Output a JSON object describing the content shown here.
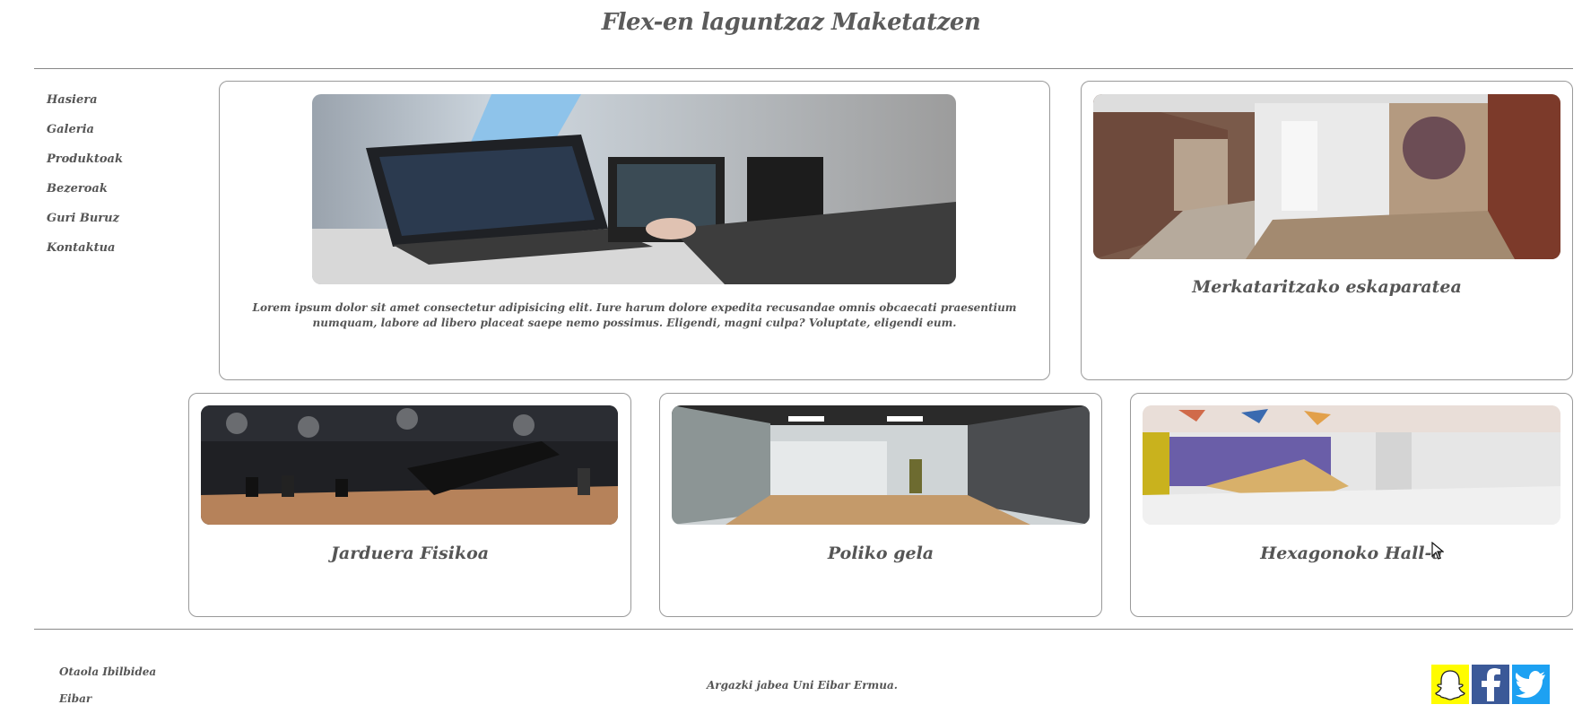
{
  "header": {
    "title": "Flex-en laguntzaz Maketatzen"
  },
  "nav": {
    "items": [
      {
        "label": "Hasiera"
      },
      {
        "label": "Galeria"
      },
      {
        "label": "Produktoak"
      },
      {
        "label": "Bezeroak"
      },
      {
        "label": "Guri Buruz"
      },
      {
        "label": "Kontaktua"
      }
    ]
  },
  "cards": {
    "main": {
      "text": "Lorem ipsum dolor sit amet consectetur adipisicing elit. Iure harum dolore expedita recusandae omnis obcaecati praesentium numquam, labore ad libero placeat saepe nemo possimus. Eligendi, magni culpa? Voluptate, eligendi eum."
    },
    "shop": {
      "caption": "Merkataritzako eskaparatea"
    },
    "gym": {
      "caption": "Jarduera Fisikoa"
    },
    "poly": {
      "caption": "Poliko gela"
    },
    "hall": {
      "caption": "Hexagonoko Hall-a"
    }
  },
  "footer": {
    "address_line1": "Otaola Ibilbidea",
    "address_line2": "Eibar",
    "credit": "Argazki jabea Uni Eibar Ermua.",
    "social": [
      "snapchat-icon",
      "facebook-icon",
      "twitter-icon"
    ]
  },
  "colors": {
    "snapchat": "#fffc00",
    "facebook": "#3b5998",
    "twitter": "#1da1f2",
    "border": "#999999",
    "text": "#555555"
  }
}
